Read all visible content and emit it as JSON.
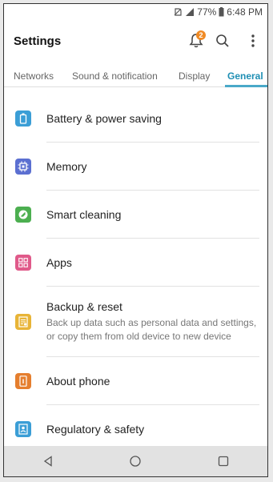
{
  "status": {
    "battery_percent": "77%",
    "time": "6:48 PM"
  },
  "header": {
    "title": "Settings",
    "notification_count": "2"
  },
  "tabs": [
    {
      "label": "Networks"
    },
    {
      "label": "Sound & notification"
    },
    {
      "label": "Display"
    },
    {
      "label": "General"
    }
  ],
  "items": [
    {
      "title": "Battery & power saving",
      "icon": "battery-icon",
      "color": "#3b9ed6"
    },
    {
      "title": "Memory",
      "icon": "memory-chip-icon",
      "color": "#5b6fd1"
    },
    {
      "title": "Smart cleaning",
      "icon": "smart-cleaning-icon",
      "color": "#4caf50"
    },
    {
      "title": "Apps",
      "icon": "apps-grid-icon",
      "color": "#e05a8a"
    },
    {
      "title": "Backup & reset",
      "subtitle": "Back up data such as personal data and settings, or copy them from old device to new device",
      "icon": "backup-icon",
      "color": "#e8b437"
    },
    {
      "title": "About phone",
      "icon": "about-phone-icon",
      "color": "#e57e2e"
    },
    {
      "title": "Regulatory & safety",
      "icon": "regulatory-icon",
      "color": "#3b9ed6"
    }
  ],
  "colors": {
    "accent": "#1f8fb4",
    "badge": "#f08a24"
  }
}
